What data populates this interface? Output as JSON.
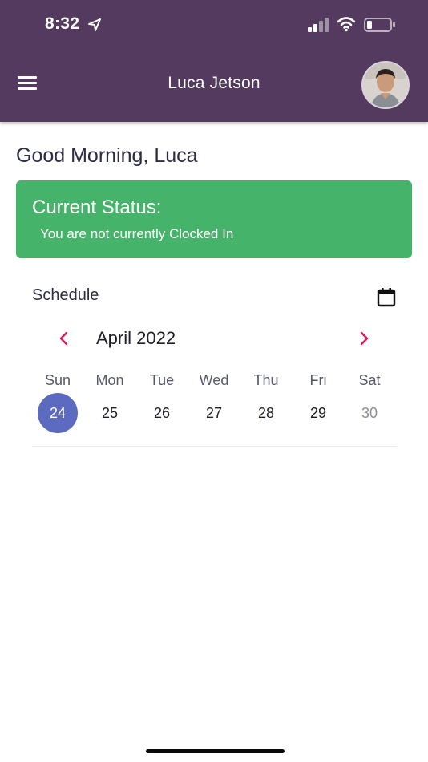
{
  "status_bar": {
    "time": "8:32"
  },
  "header": {
    "title": "Luca Jetson",
    "menu_icon": "hamburger-menu-icon",
    "avatar_icon": "user-avatar",
    "background_color": "#533a5e"
  },
  "greeting": "Good Morning, Luca",
  "status_card": {
    "title": "Current Status:",
    "message": "You are not currently Clocked In",
    "color": "#45b46a"
  },
  "schedule": {
    "label": "Schedule",
    "calendar_icon": "calendar-icon",
    "month_label": "April 2022",
    "prev_icon": "chevron-left-icon",
    "next_icon": "chevron-right-icon",
    "accent_color": "#d81b60",
    "selected_color": "#5c6bc0",
    "days": [
      {
        "dow": "Sun",
        "date": "24",
        "selected": true
      },
      {
        "dow": "Mon",
        "date": "25"
      },
      {
        "dow": "Tue",
        "date": "26"
      },
      {
        "dow": "Wed",
        "date": "27"
      },
      {
        "dow": "Thu",
        "date": "28"
      },
      {
        "dow": "Fri",
        "date": "29"
      },
      {
        "dow": "Sat",
        "date": "30",
        "muted": true
      }
    ]
  }
}
